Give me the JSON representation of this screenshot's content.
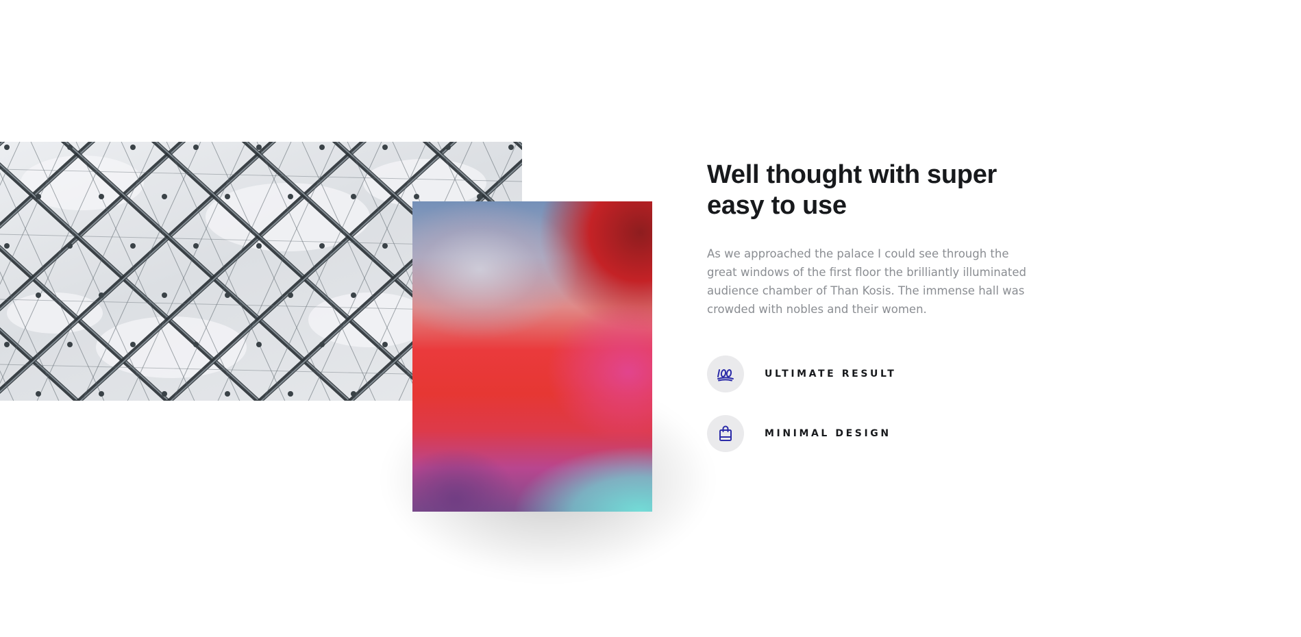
{
  "section": {
    "title_line1": "Well thought with super",
    "title_line2": "easy to use",
    "body": "As we approached the palace I could see through the great windows of the first floor the brilliantly illuminated audience chamber of Than Kosis. The immense hall was crowded with nobles and their women.",
    "features": [
      {
        "label": "ULTIMATE RESULT",
        "icon": "hundred-points-icon"
      },
      {
        "label": "MINIMAL DESIGN",
        "icon": "shopping-bag-icon"
      }
    ]
  },
  "images": {
    "left": "glass-lattice-roof-photo",
    "right": "abstract-gradient-photo"
  },
  "colors": {
    "heading": "#17191c",
    "body_text": "#8a8d92",
    "icon_accent": "#2b2ba8",
    "icon_circle": "#eaeaec",
    "background": "#ffffff"
  }
}
